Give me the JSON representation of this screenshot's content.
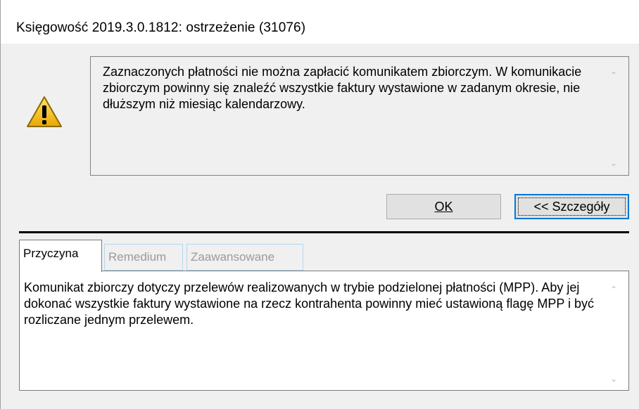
{
  "window": {
    "title": "Księgowość 2019.3.0.1812: ostrzeżenie (31076)"
  },
  "message": {
    "icon": "warning-icon",
    "text": "Zaznaczonych płatności nie można zapłacić komunikatem zbiorczym. W komunikacie zbiorczym powinny się znaleźć wszystkie faktury wystawione w zadanym okresie, nie dłuższym niż miesiąc kalendarzowy."
  },
  "buttons": {
    "ok_label": "OK",
    "details_label": "<< Szczegóły"
  },
  "tabs": [
    {
      "label": "Przyczyna",
      "active": true
    },
    {
      "label": "Remedium",
      "active": false
    },
    {
      "label": "Zaawansowane",
      "active": false
    }
  ],
  "reason": {
    "text": "Komunikat zbiorczy dotyczy przelewów realizowanych w trybie podzielonej płatności (MPP). Aby jej dokonać wszystkie faktury wystawione na rzecz kontrahenta powinny mieć ustawioną flagę MPP i być rozliczane jednym przelewem."
  },
  "colors": {
    "accent": "#0078d7",
    "warning_fill": "#f5c400",
    "background": "#f0f0f0"
  }
}
